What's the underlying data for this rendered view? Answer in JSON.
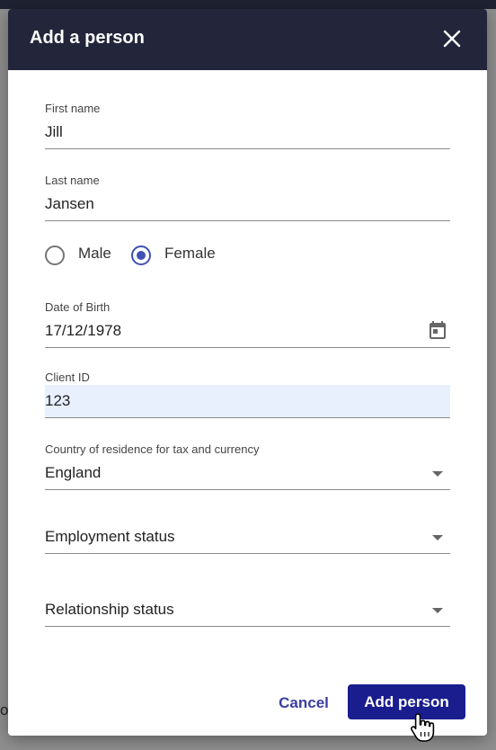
{
  "background": {
    "partial_text": "or"
  },
  "dialog": {
    "title": "Add a person",
    "close_icon": "close-icon"
  },
  "fields": {
    "first_name": {
      "label": "First name",
      "value": "Jill"
    },
    "last_name": {
      "label": "Last name",
      "value": "Jansen"
    },
    "gender": {
      "options": [
        "Male",
        "Female"
      ],
      "selected": "Female"
    },
    "dob": {
      "label": "Date of Birth",
      "value": "17/12/1978",
      "icon": "calendar-icon"
    },
    "client_id": {
      "label": "Client ID",
      "value": "123"
    },
    "country": {
      "label": "Country of residence for tax and currency",
      "value": "England"
    },
    "employment": {
      "placeholder": "Employment status"
    },
    "relationship": {
      "placeholder": "Relationship status"
    }
  },
  "actions": {
    "cancel_label": "Cancel",
    "add_label": "Add person"
  },
  "colors": {
    "header_bg": "#23263a",
    "primary": "#1a1d8e",
    "radio_accent": "#3f51b5",
    "autofill_bg": "#e8f0fe"
  }
}
